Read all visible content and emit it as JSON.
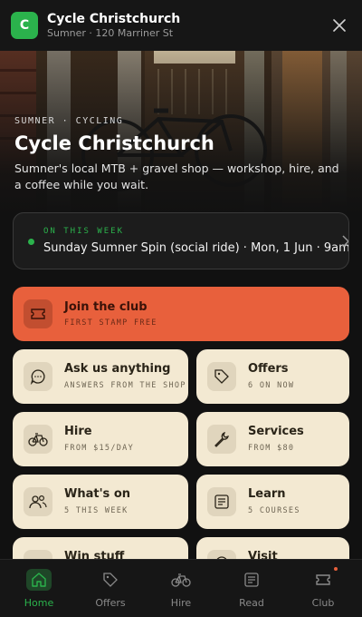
{
  "header": {
    "logo_letter": "C",
    "title": "Cycle Christchurch",
    "subtitle": "Sumner · 120 Marriner St"
  },
  "hero": {
    "eyebrow": "SUMNER · CYCLING",
    "title": "Cycle Christchurch",
    "description": "Sumner's local MTB + gravel shop — workshop, hire, and a coffee while you wait."
  },
  "event": {
    "label": "ON THIS WEEK",
    "text": "Sunday Sumner Spin (social ride) · Mon, 1 Jun · 9am"
  },
  "join": {
    "title": "Join the club",
    "subtitle": "FIRST STAMP FREE",
    "icon": "ticket-icon"
  },
  "tiles": [
    {
      "title": "Ask us anything",
      "subtitle": "ANSWERS FROM THE SHOP",
      "icon": "chat-icon"
    },
    {
      "title": "Offers",
      "subtitle": "6 ON NOW",
      "icon": "tag-icon"
    },
    {
      "title": "Hire",
      "subtitle": "FROM $15/DAY",
      "icon": "bike-icon"
    },
    {
      "title": "Services",
      "subtitle": "FROM $80",
      "icon": "wrench-icon"
    },
    {
      "title": "What's on",
      "subtitle": "5 THIS WEEK",
      "icon": "people-icon"
    },
    {
      "title": "Learn",
      "subtitle": "5 COURSES",
      "icon": "document-icon"
    },
    {
      "title": "Win stuff",
      "subtitle": "",
      "icon": "plus-icon"
    },
    {
      "title": "Visit",
      "subtitle": "",
      "icon": "location-icon"
    }
  ],
  "tabs": [
    {
      "label": "Home",
      "icon": "home-icon",
      "active": true
    },
    {
      "label": "Offers",
      "icon": "tag-icon"
    },
    {
      "label": "Hire",
      "icon": "bike-icon"
    },
    {
      "label": "Read",
      "icon": "document-icon"
    },
    {
      "label": "Club",
      "icon": "ticket-icon"
    }
  ],
  "colors": {
    "brand_green": "#2bb24c",
    "accent_orange": "#e8603c",
    "tile_cream": "#f3e9d2",
    "background": "#111111"
  }
}
